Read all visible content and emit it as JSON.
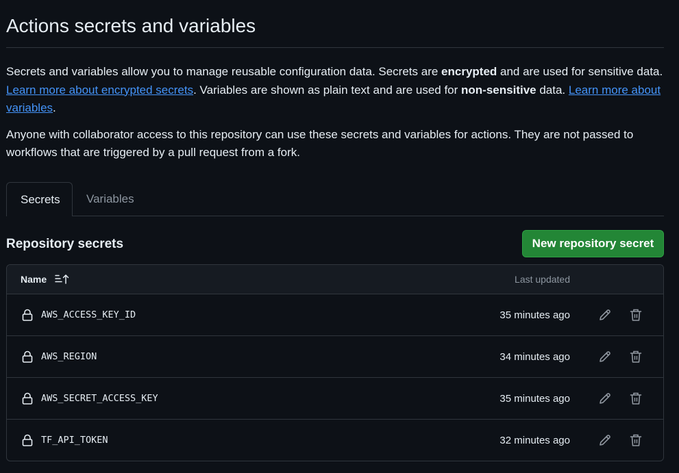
{
  "page": {
    "title": "Actions secrets and variables"
  },
  "intro": {
    "p1_a": "Secrets and variables allow you to manage reusable configuration data. Secrets are ",
    "p1_b": "encrypted",
    "p1_c": " and are used for sensitive data. ",
    "p1_link1": "Learn more about encrypted secrets",
    "p1_d": ". Variables are shown as plain text and are used for ",
    "p1_e": "non-sensitive",
    "p1_f": " data. ",
    "p1_link2": "Learn more about variables",
    "p1_g": ".",
    "p2": "Anyone with collaborator access to this repository can use these secrets and variables for actions. They are not passed to workflows that are triggered by a pull request from a fork."
  },
  "tabs": [
    {
      "label": "Secrets",
      "active": true
    },
    {
      "label": "Variables",
      "active": false
    }
  ],
  "section": {
    "title": "Repository secrets",
    "new_button": "New repository secret"
  },
  "table": {
    "col_name": "Name",
    "col_updated": "Last updated",
    "rows": [
      {
        "name": "AWS_ACCESS_KEY_ID",
        "updated": "35 minutes ago"
      },
      {
        "name": "AWS_REGION",
        "updated": "34 minutes ago"
      },
      {
        "name": "AWS_SECRET_ACCESS_KEY",
        "updated": "35 minutes ago"
      },
      {
        "name": "TF_API_TOKEN",
        "updated": "32 minutes ago"
      }
    ]
  },
  "colors": {
    "background": "#0d1117",
    "border": "#30363d",
    "header_bg": "#161b22",
    "link": "#4493f8",
    "primary_button": "#238636",
    "muted_text": "#8d96a0"
  },
  "icons": {
    "sort": "sort-ascending-icon",
    "lock": "lock-icon",
    "edit": "pencil-icon",
    "delete": "trash-icon"
  }
}
